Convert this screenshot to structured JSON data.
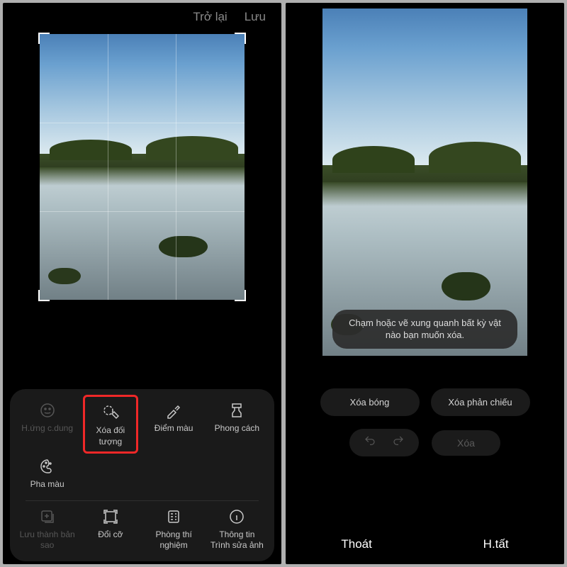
{
  "left": {
    "header": {
      "back": "Trở lại",
      "save": "Lưu"
    },
    "tools_top": [
      {
        "name": "portrait-effect",
        "label": "H.ứng c.dung",
        "dim": true
      },
      {
        "name": "object-eraser",
        "label": "Xóa đối tượng",
        "highlighted": true
      },
      {
        "name": "color-picker",
        "label": "Điểm màu"
      },
      {
        "name": "style",
        "label": "Phong cách"
      }
    ],
    "tools_top2": [
      {
        "name": "color-mix",
        "label": "Pha màu"
      }
    ],
    "tools_bottom": [
      {
        "name": "save-copy",
        "label": "Lưu thành bản sao",
        "dim": true
      },
      {
        "name": "resize",
        "label": "Đổi cỡ"
      },
      {
        "name": "labs",
        "label": "Phòng thí nghiệm"
      },
      {
        "name": "info",
        "label": "Thông tin Trình sửa ảnh"
      }
    ]
  },
  "right": {
    "hint": "Chạm hoặc vẽ xung quanh bất kỳ vật nào bạn muốn xóa.",
    "actions": {
      "erase_shadow": "Xóa bóng",
      "erase_reflection": "Xóa phản chiếu"
    },
    "delete": "Xóa",
    "footer": {
      "exit": "Thoát",
      "done": "H.tất"
    }
  }
}
